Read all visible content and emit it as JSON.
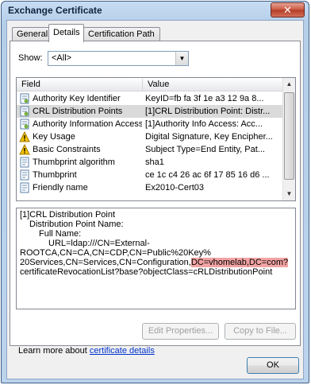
{
  "window": {
    "title": "Exchange Certificate",
    "close_glyph": "✕"
  },
  "tabs": [
    {
      "label": "General"
    },
    {
      "label": "Details"
    },
    {
      "label": "Certification Path"
    }
  ],
  "show": {
    "label": "Show:",
    "value": "<All>"
  },
  "list": {
    "headers": {
      "field": "Field",
      "value": "Value"
    },
    "rows": [
      {
        "field": "Authority Key Identifier",
        "value": "KeyID=fb fa 3f 1e a3 12 9a 8...",
        "icon": "document-icon"
      },
      {
        "field": "CRL Distribution Points",
        "value": "[1]CRL Distribution Point: Distr...",
        "icon": "document-icon"
      },
      {
        "field": "Authority Information Access",
        "value": "[1]Authority Info Access: Acc...",
        "icon": "document-icon"
      },
      {
        "field": "Key Usage",
        "value": "Digital Signature, Key Encipher...",
        "icon": "warning-icon"
      },
      {
        "field": "Basic Constraints",
        "value": "Subject Type=End Entity, Pat...",
        "icon": "warning-icon"
      },
      {
        "field": "Thumbprint algorithm",
        "value": "sha1",
        "icon": "document-icon"
      },
      {
        "field": "Thumbprint",
        "value": "ce 1c c4 26 ac 6f 17 85 16 d6 ...",
        "icon": "document-icon"
      },
      {
        "field": "Friendly name",
        "value": "Ex2010-Cert03",
        "icon": "document-icon"
      }
    ],
    "selected_index": 1
  },
  "detail": {
    "line1": "[1]CRL Distribution Point",
    "line2": "Distribution Point Name:",
    "line3": "Full Name:",
    "line4": "URL=ldap:///CN=External-",
    "line5": "ROOTCA,CN=CA,CN=CDP,CN=Public%20Key%",
    "line6a": "20Services,CN=Services,CN=Configuration,",
    "line6b": "DC=vhomelab,DC=com?",
    "line7": "certificateRevocationList?base?objectClass=cRLDistributionPoint"
  },
  "buttons": {
    "edit_properties": "Edit Properties...",
    "copy_to_file": "Copy to File...",
    "ok": "OK"
  },
  "learn_more": {
    "prefix": "Learn more about ",
    "link": "certificate details"
  }
}
